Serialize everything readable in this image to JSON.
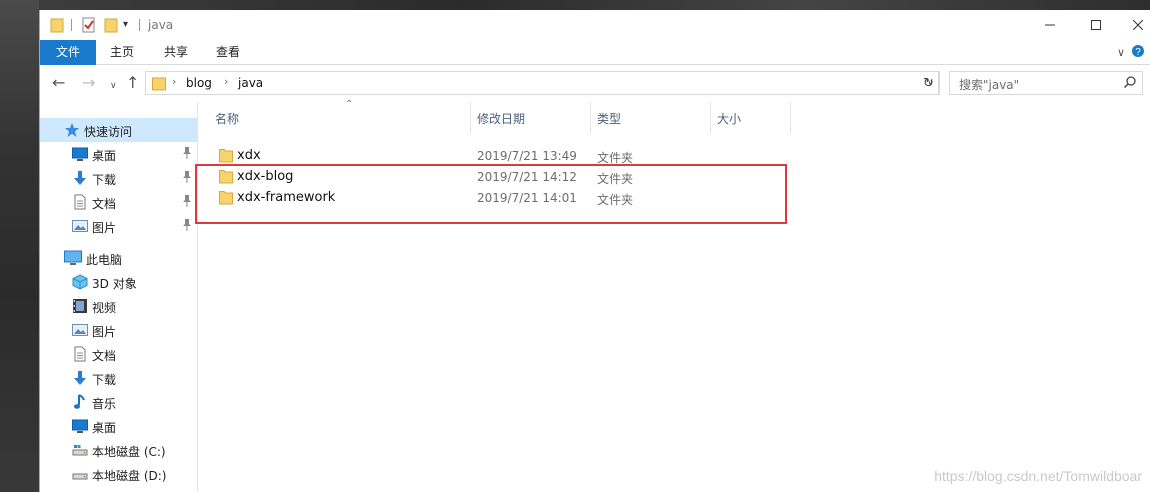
{
  "window": {
    "title": "java"
  },
  "ribbon": {
    "tabs": [
      {
        "label": "文件",
        "active": true
      },
      {
        "label": "主页"
      },
      {
        "label": "共享"
      },
      {
        "label": "查看"
      }
    ]
  },
  "address": {
    "breadcrumbs": [
      "blog",
      "java"
    ],
    "search_placeholder": "搜索\"java\""
  },
  "sidebar": {
    "quick_access": {
      "label": "快速访问",
      "icon": "star-icon"
    },
    "quick_items": [
      {
        "label": "桌面",
        "icon": "desktop-icon",
        "pinned": true
      },
      {
        "label": "下载",
        "icon": "download-icon",
        "pinned": true
      },
      {
        "label": "文档",
        "icon": "document-icon",
        "pinned": true
      },
      {
        "label": "图片",
        "icon": "picture-icon",
        "pinned": true
      }
    ],
    "this_pc": {
      "label": "此电脑",
      "icon": "computer-icon"
    },
    "pc_items": [
      {
        "label": "3D 对象",
        "icon": "cube-icon"
      },
      {
        "label": "视频",
        "icon": "video-icon"
      },
      {
        "label": "图片",
        "icon": "picture-icon"
      },
      {
        "label": "文档",
        "icon": "document-icon"
      },
      {
        "label": "下载",
        "icon": "download-icon"
      },
      {
        "label": "音乐",
        "icon": "music-icon"
      },
      {
        "label": "桌面",
        "icon": "desktop-icon"
      },
      {
        "label": "本地磁盘 (C:)",
        "icon": "drive-icon"
      },
      {
        "label": "本地磁盘 (D:)",
        "icon": "drive-icon"
      }
    ]
  },
  "columns": {
    "name": "名称",
    "date": "修改日期",
    "type": "类型",
    "size": "大小"
  },
  "files": [
    {
      "name": "xdx",
      "date": "2019/7/21 13:49",
      "type": "文件夹"
    },
    {
      "name": "xdx-blog",
      "date": "2019/7/21 14:12",
      "type": "文件夹"
    },
    {
      "name": "xdx-framework",
      "date": "2019/7/21 14:01",
      "type": "文件夹"
    }
  ],
  "watermark": "https://blog.csdn.net/Tomwildboar",
  "colors": {
    "accent": "#1979ca",
    "selection": "#cde8ff",
    "highlight_box": "#e0383e",
    "folder": "#f6d36b"
  }
}
